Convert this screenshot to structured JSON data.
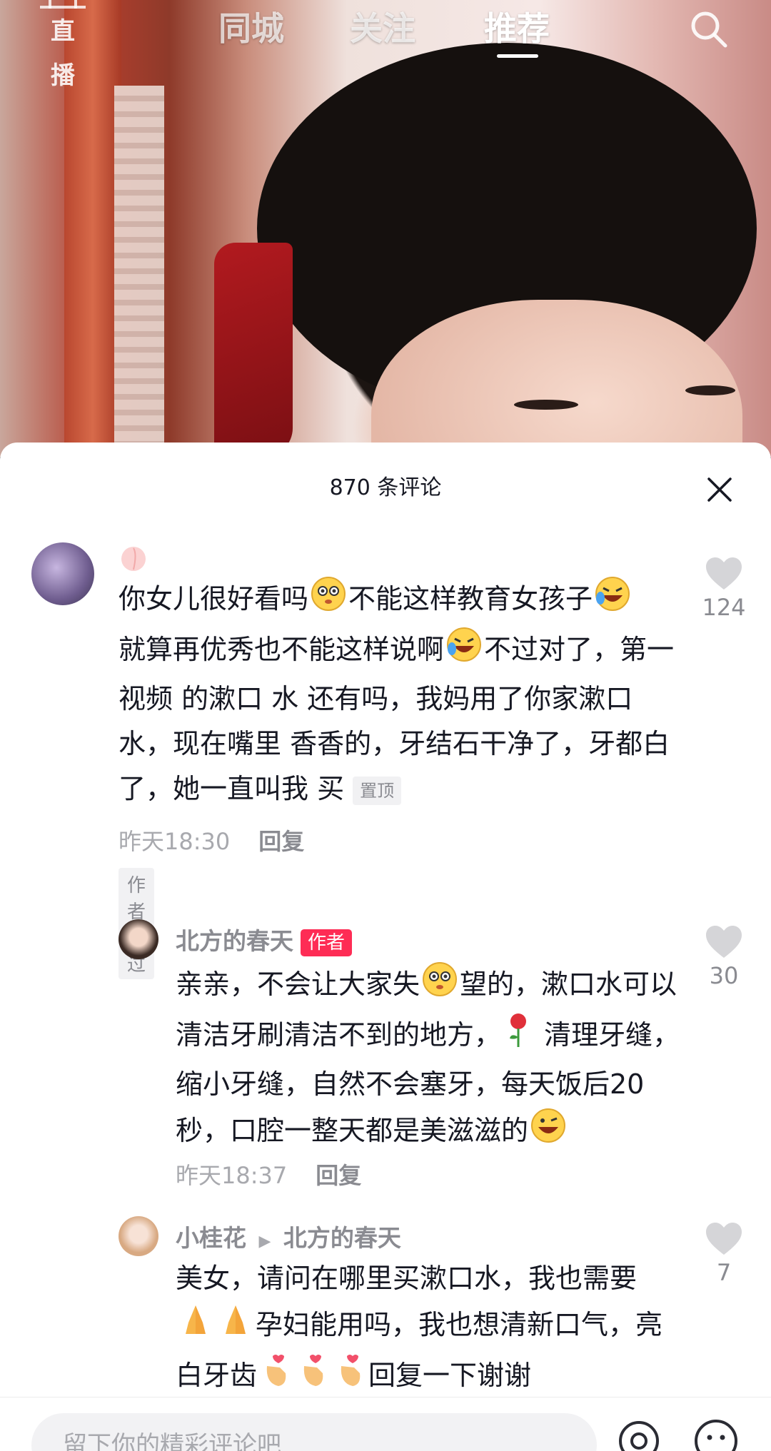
{
  "topnav": {
    "live": "直播",
    "tabs": [
      "同城",
      "关注",
      "推荐"
    ],
    "active_tab": "推荐"
  },
  "comments_sheet": {
    "title": "870 条评论",
    "comments": [
      {
        "username_emoji": "peach",
        "text_parts": [
          "你女儿很好看吗",
          "不能这样教育女孩子",
          "就算再优秀也不能这样说啊",
          "不过对了，第一 视频 的漱口 水 还有吗，我妈用了你家漱口水，现在嘴里 香香的，牙结石干净了，牙都白了，她一直叫我 买"
        ],
        "pinned_label": "置顶",
        "time": "昨天18:30",
        "reply_label": "回复",
        "liked_label": "作者赞过",
        "likes": "124"
      },
      {
        "username": "北方的春天",
        "badge": "作者",
        "text_parts": [
          "亲亲，不会让大家失",
          "望的，漱口水可以清洁牙刷清洁不到的地方，",
          " 清理牙缝，缩小牙缝，自然不会塞牙，每天饭后20秒，口腔一整天都是美滋滋的"
        ],
        "time": "昨天18:37",
        "reply_label": "回复",
        "likes": "30"
      },
      {
        "username": "小桂花",
        "reply_to": "北方的春天",
        "text_parts": [
          "美女，请问在哪里买漱口水，我也需要",
          "孕妇能用吗，我也想清新口气，亮白牙齿",
          "回复一下谢谢"
        ],
        "likes": "7"
      }
    ]
  },
  "input": {
    "placeholder": "留下你的精彩评论吧"
  },
  "colors": {
    "accent": "#fe2c55",
    "text_primary": "#161823",
    "text_secondary": "#8a8b91"
  }
}
